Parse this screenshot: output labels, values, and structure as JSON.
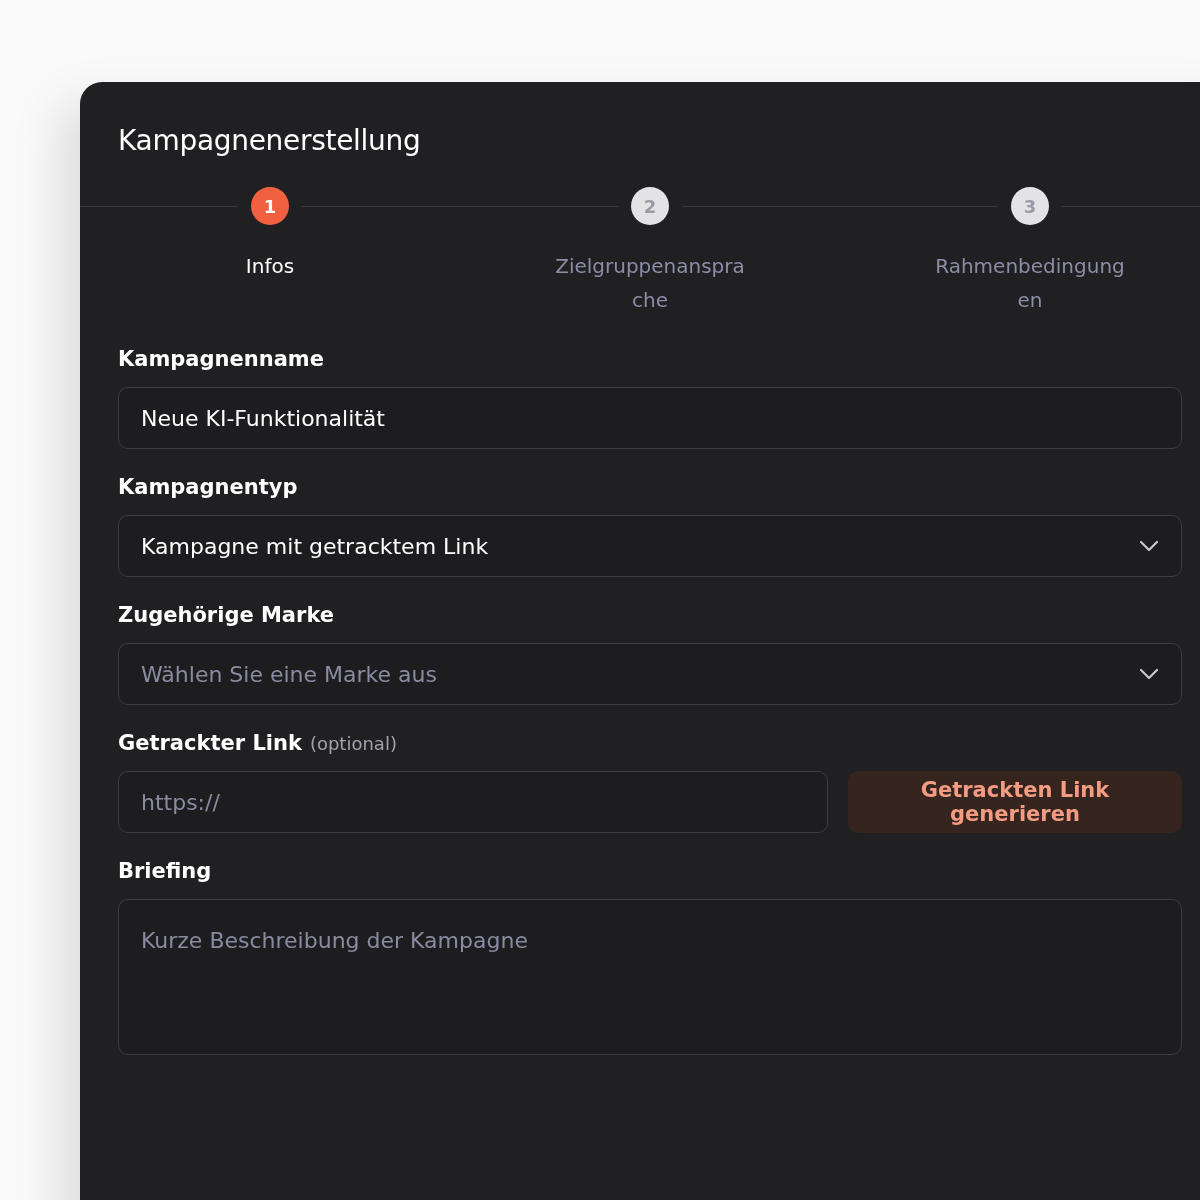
{
  "title": "Kampagnenerstellung",
  "steps": [
    {
      "number": "1",
      "label": "Infos",
      "selected": true
    },
    {
      "number": "2",
      "label": "Zielgruppenansprache",
      "selected": false
    },
    {
      "number": "3",
      "label": "Rahmenbedingungen",
      "selected": false
    }
  ],
  "fields": [
    {
      "kind": "text",
      "label": "Kampagnenname",
      "value": "Neue KI-Funktionalität"
    },
    {
      "kind": "select",
      "label": "Kampagnentyp",
      "value": "Kampagne mit getracktem Link"
    },
    {
      "kind": "select",
      "label": "Zugehörige Marke",
      "placeholder": "Wählen Sie eine Marke aus"
    },
    {
      "kind": "link",
      "label": "Getrackter Link",
      "hint": "(optional)",
      "placeholder": "https://",
      "button": "Getrackten Link generieren"
    },
    {
      "kind": "textarea",
      "label": "Briefing",
      "placeholder": "Kurze Beschreibung der Kampagne"
    }
  ]
}
